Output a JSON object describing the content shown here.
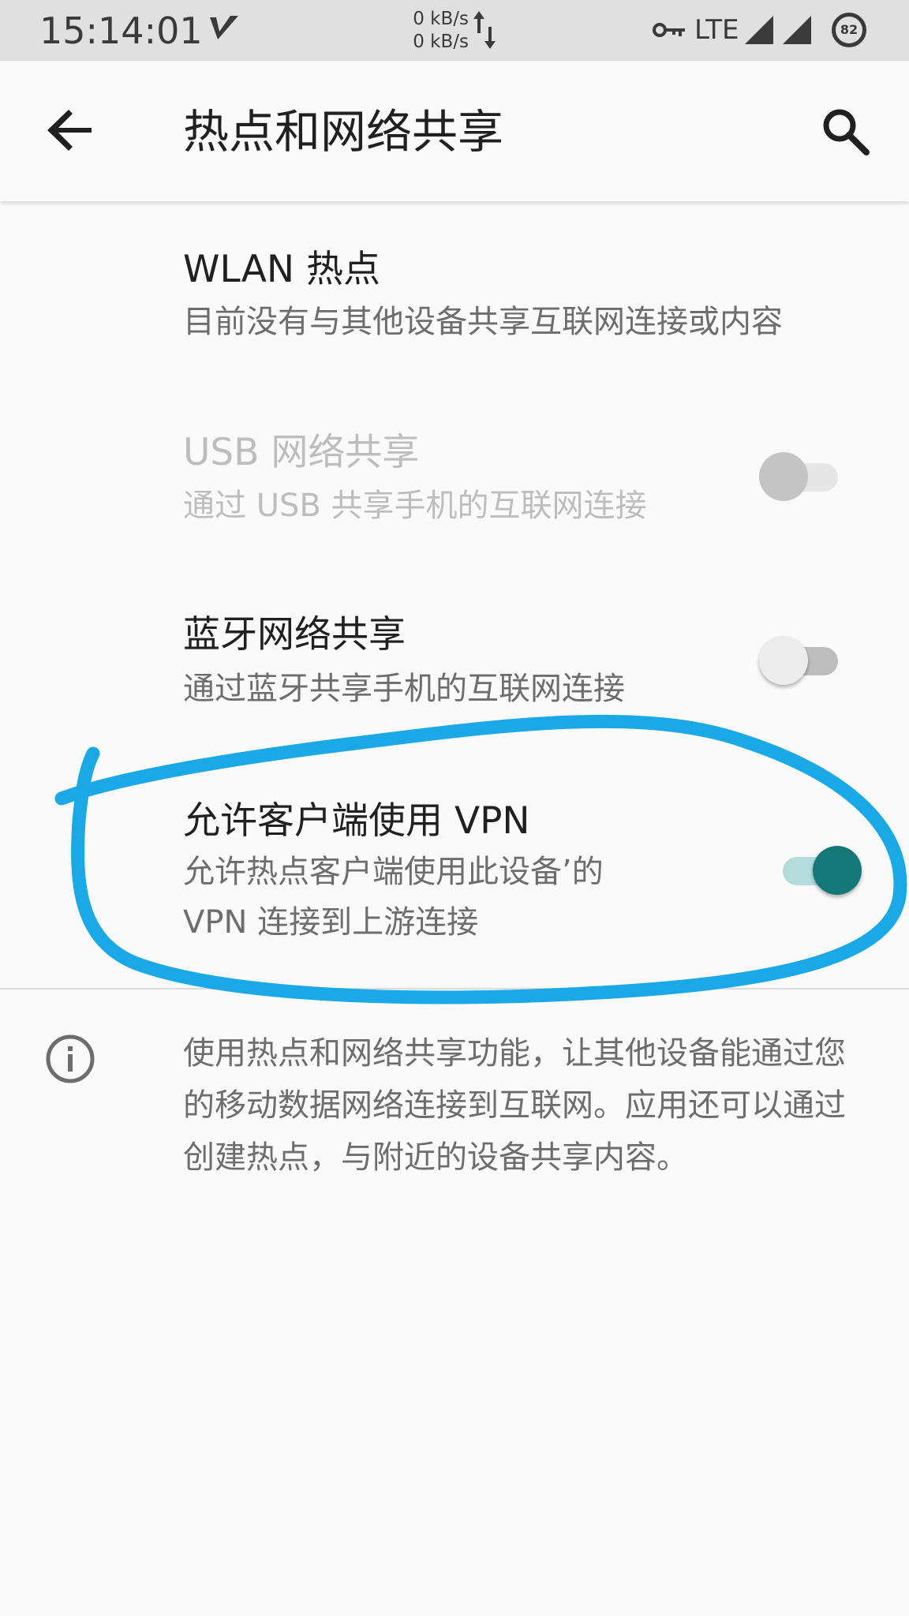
{
  "status_bar": {
    "time": "15:14:01",
    "net_up": "0 kB/s",
    "net_down": "0 kB/s",
    "network_type": "LTE",
    "battery_level": "82"
  },
  "app_bar": {
    "title": "热点和网络共享"
  },
  "settings": {
    "wlan_hotspot": {
      "title": "WLAN 热点",
      "summary": "目前没有与其他设备共享互联网连接或内容"
    },
    "usb_tethering": {
      "title": "USB 网络共享",
      "summary": "通过 USB 共享手机的互联网连接",
      "enabled": false,
      "checked": false
    },
    "bluetooth_tethering": {
      "title": "蓝牙网络共享",
      "summary": "通过蓝牙共享手机的互联网连接",
      "enabled": true,
      "checked": false
    },
    "vpn_for_clients": {
      "title": "允许客户端使用 VPN",
      "summary_line1": "允许热点客户端使用此设备’的",
      "summary_line2": "VPN 连接到上游连接",
      "enabled": true,
      "checked": true
    }
  },
  "footer": {
    "text": "使用热点和网络共享功能，让其他设备能通过您的移动数据网络连接到互联网。应用还可以通过创建热点，与附近的设备共享内容。"
  },
  "colors": {
    "accent": "#157878",
    "accent_track": "#b5dbdc",
    "annotation": "#1aa9e6"
  }
}
